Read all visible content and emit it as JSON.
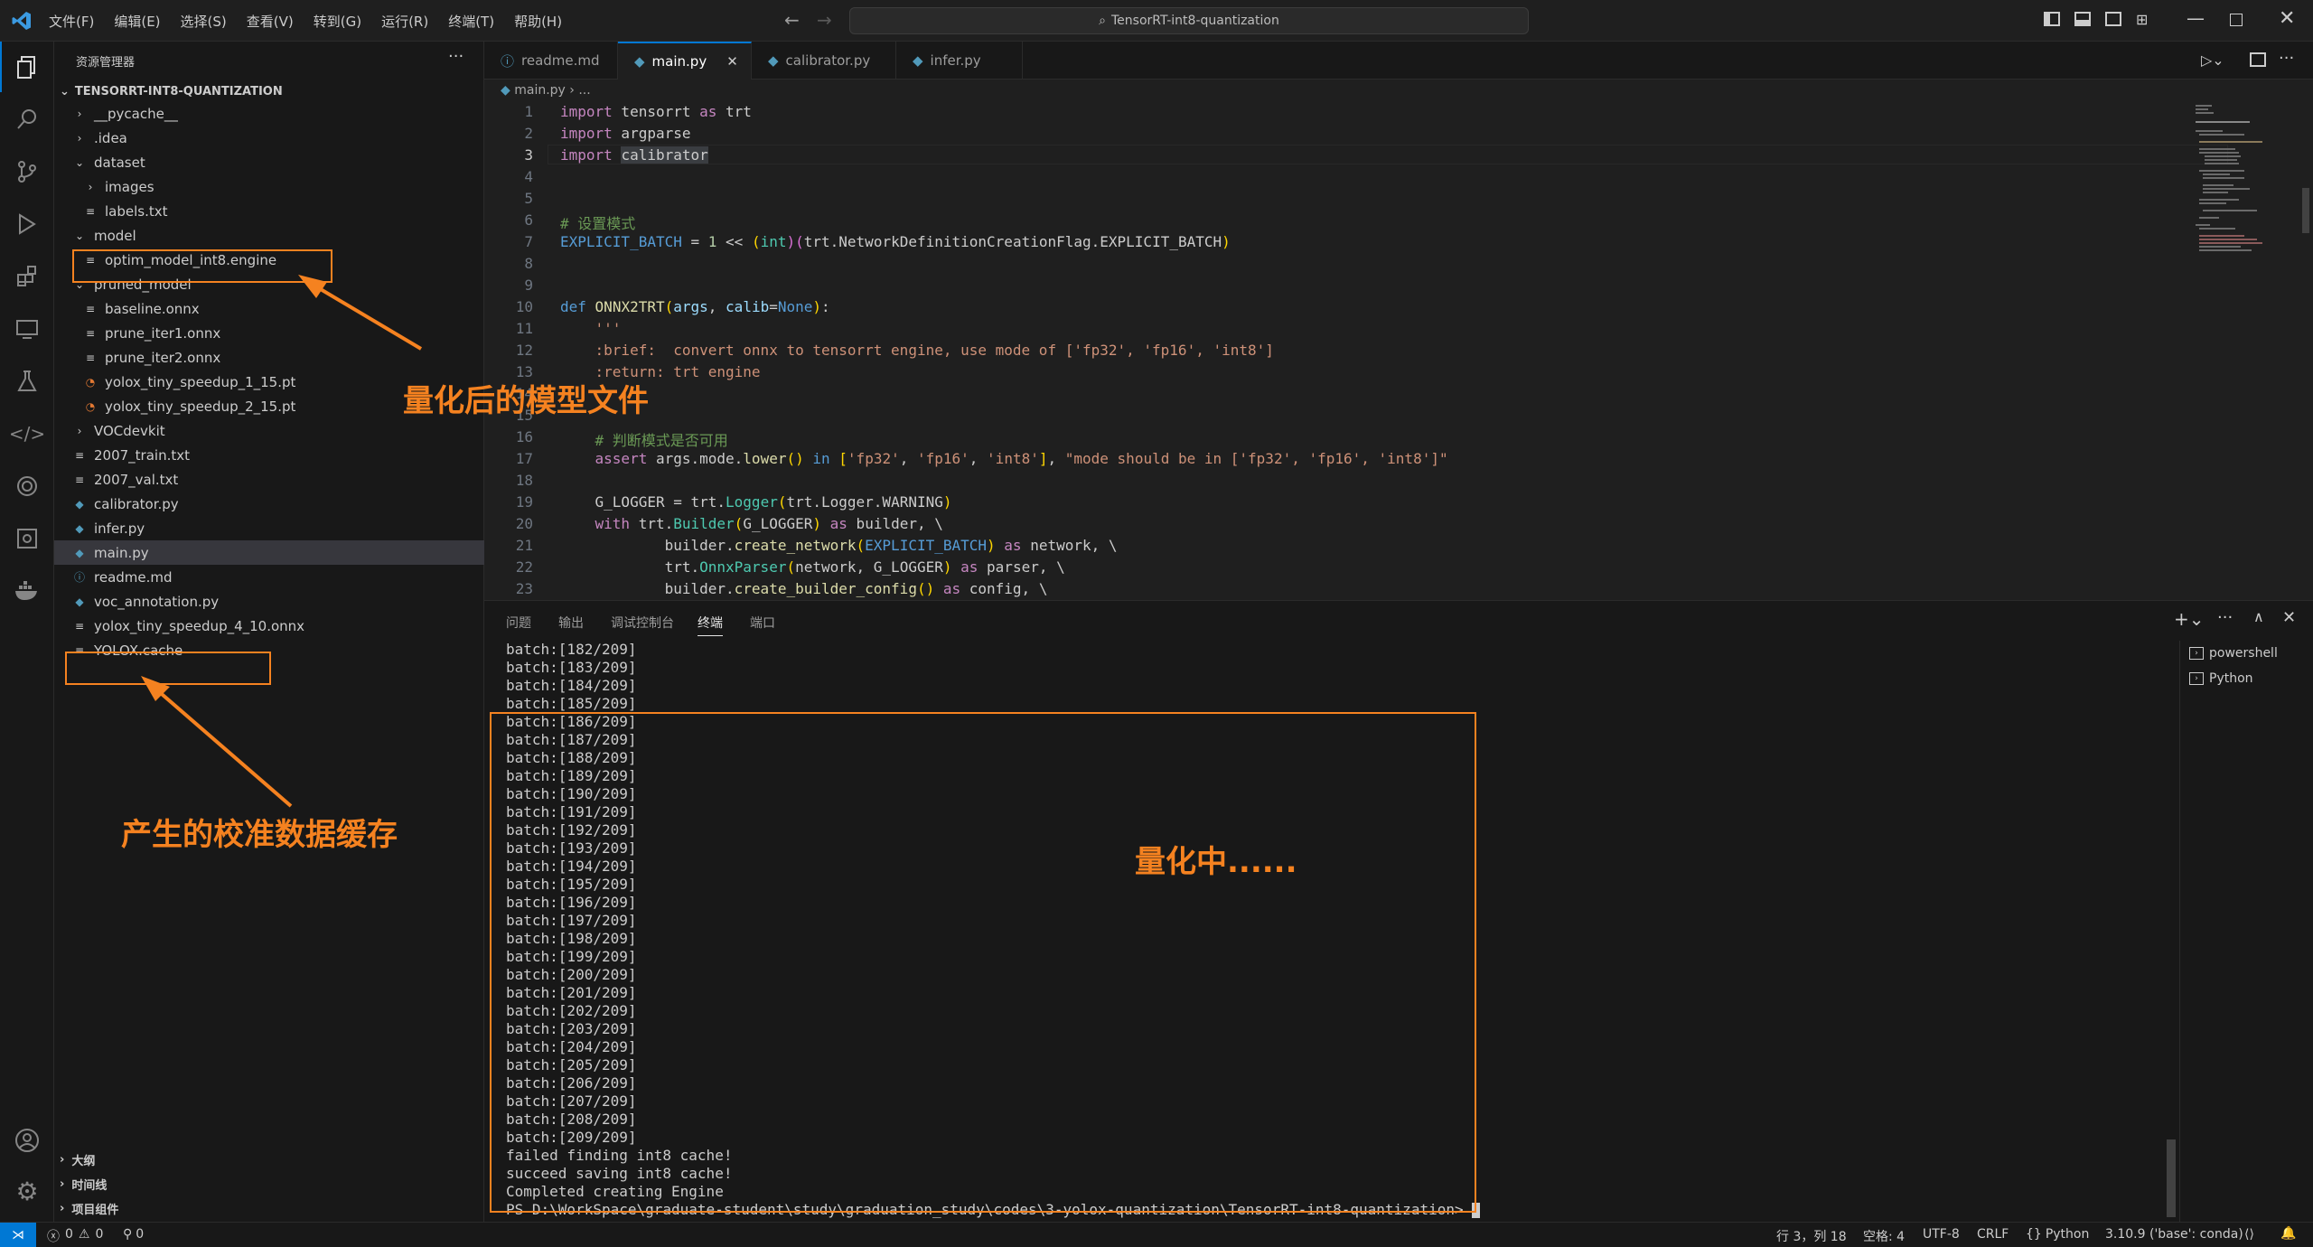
{
  "menu": [
    "文件(F)",
    "编辑(E)",
    "选择(S)",
    "查看(V)",
    "转到(G)",
    "运行(R)",
    "终端(T)",
    "帮助(H)"
  ],
  "search": {
    "text": "TensorRT-int8-quantization"
  },
  "explorer": {
    "title": "资源管理器",
    "root": "TENSORRT-INT8-QUANTIZATION",
    "items": [
      {
        "label": "__pycache__",
        "kind": "folder-closed"
      },
      {
        "label": ".idea",
        "kind": "folder-closed"
      },
      {
        "label": "dataset",
        "kind": "folder-open"
      },
      {
        "label": "images",
        "kind": "folder-closed"
      },
      {
        "label": "labels.txt",
        "kind": "file"
      },
      {
        "label": "model",
        "kind": "folder-open"
      },
      {
        "label": "optim_model_int8.engine",
        "kind": "file"
      },
      {
        "label": "pruned_model",
        "kind": "folder-open"
      },
      {
        "label": "baseline.onnx",
        "kind": "file"
      },
      {
        "label": "prune_iter1.onnx",
        "kind": "file"
      },
      {
        "label": "prune_iter2.onnx",
        "kind": "file"
      },
      {
        "label": "yolox_tiny_speedup_1_15.pt",
        "kind": "rss"
      },
      {
        "label": "yolox_tiny_speedup_2_15.pt",
        "kind": "rss"
      },
      {
        "label": "VOCdevkit",
        "kind": "folder-closed"
      },
      {
        "label": "2007_train.txt",
        "kind": "file"
      },
      {
        "label": "2007_val.txt",
        "kind": "file"
      },
      {
        "label": "calibrator.py",
        "kind": "py"
      },
      {
        "label": "infer.py",
        "kind": "py"
      },
      {
        "label": "main.py",
        "kind": "py"
      },
      {
        "label": "readme.md",
        "kind": "info"
      },
      {
        "label": "voc_annotation.py",
        "kind": "py"
      },
      {
        "label": "yolox_tiny_speedup_4_10.onnx",
        "kind": "file"
      },
      {
        "label": "YOLOX.cache",
        "kind": "file"
      }
    ],
    "bottom_sections": [
      "大纲",
      "时间线",
      "项目组件"
    ]
  },
  "tabs": [
    {
      "label": "readme.md",
      "icon": "info-icon"
    },
    {
      "label": "main.py",
      "icon": "python-icon"
    },
    {
      "label": "calibrator.py",
      "icon": "python-icon"
    },
    {
      "label": "infer.py",
      "icon": "python-icon"
    }
  ],
  "breadcrumb": {
    "file": "main.py",
    "rest": "..."
  },
  "code_line_numbers": [
    "1",
    "2",
    "3",
    "4",
    "5",
    "6",
    "7",
    "8",
    "9",
    "10",
    "11",
    "12",
    "13",
    "14",
    "15",
    "16",
    "17",
    "18",
    "19",
    "20",
    "21",
    "22",
    "23"
  ],
  "panel": {
    "tabs": [
      "问题",
      "输出",
      "调试控制台",
      "终端",
      "端口"
    ],
    "active_tab": "终端",
    "terminals": [
      "powershell",
      "Python"
    ],
    "lines": [
      "batch:[182/209]",
      "batch:[183/209]",
      "batch:[184/209]",
      "batch:[185/209]",
      "batch:[186/209]",
      "batch:[187/209]",
      "batch:[188/209]",
      "batch:[189/209]",
      "batch:[190/209]",
      "batch:[191/209]",
      "batch:[192/209]",
      "batch:[193/209]",
      "batch:[194/209]",
      "batch:[195/209]",
      "batch:[196/209]",
      "batch:[197/209]",
      "batch:[198/209]",
      "batch:[199/209]",
      "batch:[200/209]",
      "batch:[201/209]",
      "batch:[202/209]",
      "batch:[203/209]",
      "batch:[204/209]",
      "batch:[205/209]",
      "batch:[206/209]",
      "batch:[207/209]",
      "batch:[208/209]",
      "batch:[209/209]",
      "failed finding int8 cache!",
      "succeed saving int8 cache!",
      "Completed creating Engine",
      "PS D:\\WorkSpace\\graduate-student\\study\\graduation_study\\codes\\3-yolox-quantization\\TensorRT-int8-quantization> "
    ]
  },
  "annotations": {
    "model_file": "量化后的模型文件",
    "cache_file": "产生的校准数据缓存",
    "quantizing": "量化中......"
  },
  "status": {
    "errors": "0",
    "warnings": "0",
    "ports": "0",
    "position": "行 3，列 18",
    "spaces": "空格: 4",
    "encoding": "UTF-8",
    "eol": "CRLF",
    "language": "Python",
    "interpreter": "3.10.9 ('base': conda)"
  },
  "colors": {
    "accent": "#0078d4",
    "annotation": "#f58220"
  }
}
